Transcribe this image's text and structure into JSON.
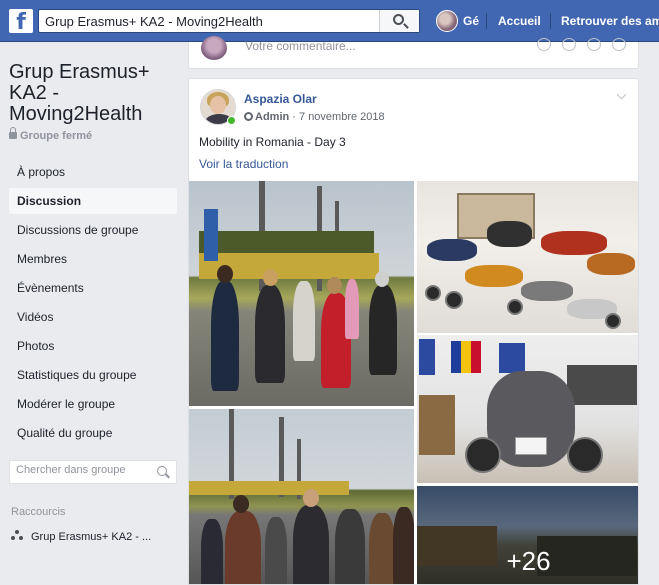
{
  "topbar": {
    "logo": "f",
    "search_value": "Grup Erasmus+ KA2 - Moving2Health",
    "search_icon": "magnifier-icon",
    "user_name": "Gé",
    "links": [
      "Accueil",
      "Retrouver des amis"
    ]
  },
  "sidebar": {
    "group_title": "Grup Erasmus+ KA2 - Moving2Health",
    "group_type": "Groupe fermé",
    "items": [
      {
        "label": "À propos",
        "active": false
      },
      {
        "label": "Discussion",
        "active": true
      },
      {
        "label": "Discussions de groupe",
        "active": false
      },
      {
        "label": "Membres",
        "active": false
      },
      {
        "label": "Évènements",
        "active": false
      },
      {
        "label": "Vidéos",
        "active": false
      },
      {
        "label": "Photos",
        "active": false
      },
      {
        "label": "Statistiques du groupe",
        "active": false
      },
      {
        "label": "Modérer le groupe",
        "active": false
      },
      {
        "label": "Qualité du groupe",
        "active": false
      }
    ],
    "search_placeholder": "Chercher dans groupe",
    "shortcuts_label": "Raccourcis",
    "shortcut_item": "Grup Erasmus+ KA2 - ..."
  },
  "composer": {
    "placeholder": "Votre commentaire..."
  },
  "post": {
    "author": "Aspazia Olar",
    "role": "Admin",
    "date": "· 7 novembre 2018",
    "text": "Mobility in Romania - Day 3",
    "translate_link": "Voir la traduction",
    "more_photos": "+26"
  },
  "colors": {
    "brand": "#4267b2",
    "link": "#365899",
    "background": "#e9ebee",
    "online": "#42b72a"
  }
}
